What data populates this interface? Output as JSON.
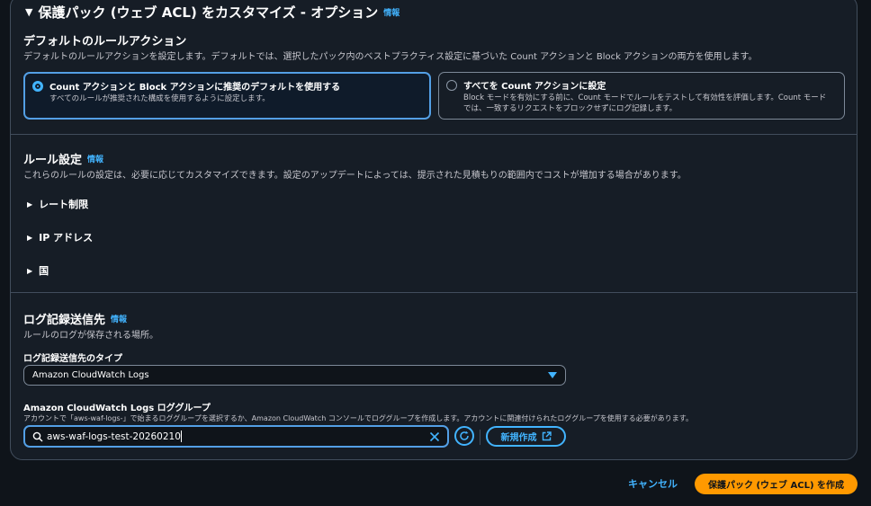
{
  "header": {
    "title": "保護パック (ウェブ ACL) をカスタマイズ - オプション",
    "info": "情報"
  },
  "default_action": {
    "title": "デフォルトのルールアクション",
    "description": "デフォルトのルールアクションを設定します。デフォルトでは、選択したパック内のベストプラクティス設定に基づいた Count アクションと Block アクションの両方を使用します。",
    "options": [
      {
        "label": "Count アクションと Block アクションに推奨のデフォルトを使用する",
        "description": "すべてのルールが推奨された構成を使用するように設定します。",
        "selected": true
      },
      {
        "label": "すべてを Count アクションに設定",
        "description_line1": "Block モードを有効にする前に、Count モードでルールをテストして有効性を評価します。Count モード",
        "description_line2": "では、一致するリクエストをブロックせずにログ記録します。",
        "selected": false
      }
    ]
  },
  "rule_settings": {
    "title": "ルール設定",
    "info": "情報",
    "description": "これらのルールの設定は、必要に応じてカスタマイズできます。設定のアップデートによっては、提示された見積もりの範囲内でコストが増加する場合があります。",
    "sections": [
      "レート制限",
      "IP アドレス",
      "国"
    ]
  },
  "logging": {
    "title": "ログ記録送信先",
    "info": "情報",
    "description": "ルールのログが保存される場所。",
    "type_label": "ログ記録送信先のタイプ",
    "type_value": "Amazon CloudWatch Logs",
    "group_label": "Amazon CloudWatch Logs ロググループ",
    "group_hint": "アカウントで「aws-waf-logs-」で始まるロググループを選択するか、Amazon CloudWatch コンソールでロググループを作成します。アカウントに関連付けられたロググループを使用する必要があります。",
    "group_value": "aws-waf-logs-test-20260210",
    "create_label": "新規作成"
  },
  "footer": {
    "cancel_label": "キャンセル",
    "submit_label": "保護パック (ウェブ ACL) を作成"
  },
  "colors": {
    "accent": "#42b4ff",
    "primary": "#ff9900",
    "background": "#0f141a",
    "panel": "#161d26"
  }
}
